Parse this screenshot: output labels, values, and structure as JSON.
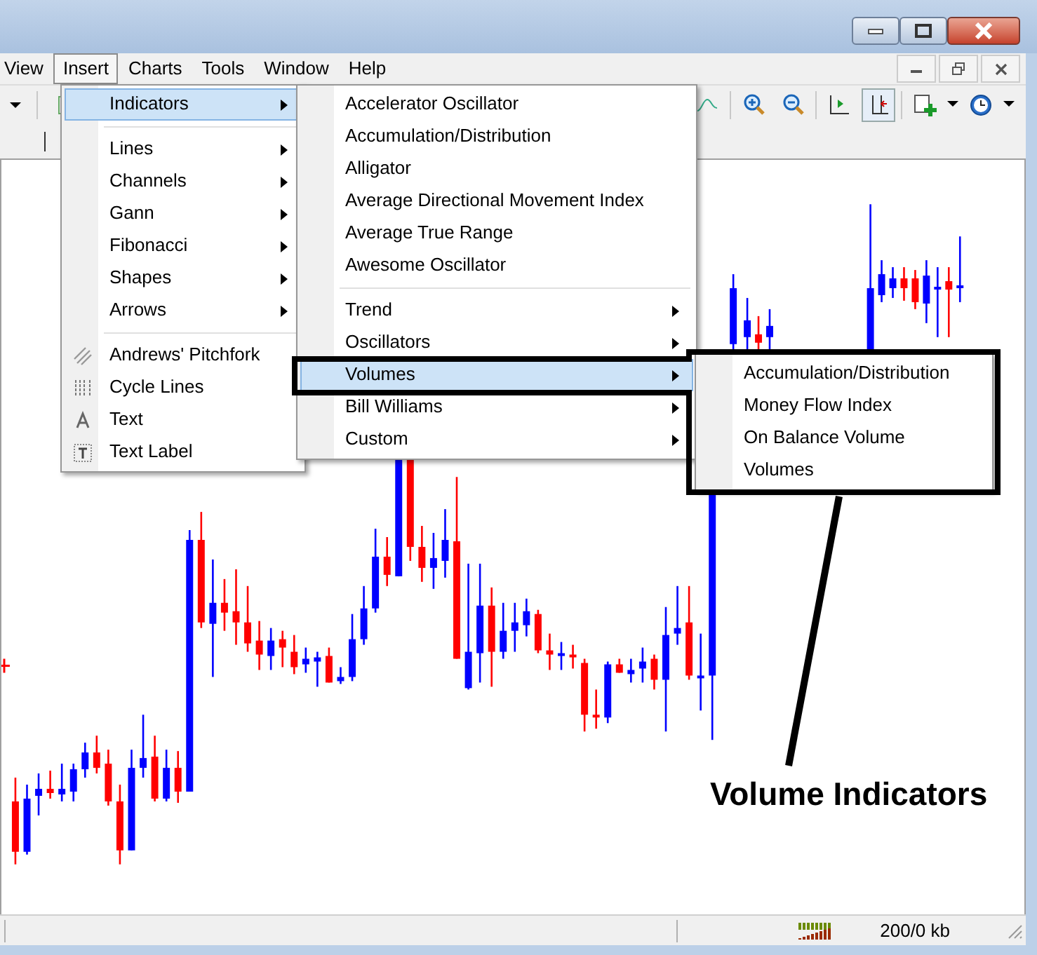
{
  "menu_bar": [
    {
      "label": "View",
      "selected": false
    },
    {
      "label": "Insert",
      "selected": true
    },
    {
      "label": "Charts",
      "selected": false
    },
    {
      "label": "Tools",
      "selected": false
    },
    {
      "label": "Window",
      "selected": false
    },
    {
      "label": "Help",
      "selected": false
    }
  ],
  "insert_menu": [
    {
      "kind": "submenu",
      "label": "Indicators",
      "selected": true
    },
    {
      "kind": "separator"
    },
    {
      "kind": "submenu",
      "label": "Lines",
      "selected": false
    },
    {
      "kind": "submenu",
      "label": "Channels",
      "selected": false
    },
    {
      "kind": "submenu",
      "label": "Gann",
      "selected": false
    },
    {
      "kind": "submenu",
      "label": "Fibonacci",
      "selected": false
    },
    {
      "kind": "submenu",
      "label": "Shapes",
      "selected": false
    },
    {
      "kind": "submenu",
      "label": "Arrows",
      "selected": false
    },
    {
      "kind": "separator"
    },
    {
      "kind": "command",
      "label": "Andrews' Pitchfork",
      "selected": false
    },
    {
      "kind": "command",
      "label": "Cycle Lines",
      "selected": false
    },
    {
      "kind": "command",
      "label": "Text",
      "selected": false
    },
    {
      "kind": "command",
      "label": "Text Label",
      "selected": false
    }
  ],
  "indicators_menu": [
    {
      "kind": "command",
      "label": "Accelerator Oscillator",
      "selected": false
    },
    {
      "kind": "command",
      "label": "Accumulation/Distribution",
      "selected": false
    },
    {
      "kind": "command",
      "label": "Alligator",
      "selected": false
    },
    {
      "kind": "command",
      "label": "Average Directional Movement Index",
      "selected": false
    },
    {
      "kind": "command",
      "label": "Average True Range",
      "selected": false
    },
    {
      "kind": "command",
      "label": "Awesome Oscillator",
      "selected": false
    },
    {
      "kind": "separator"
    },
    {
      "kind": "submenu",
      "label": "Trend",
      "selected": false
    },
    {
      "kind": "submenu",
      "label": "Oscillators",
      "selected": false
    },
    {
      "kind": "submenu",
      "label": "Volumes",
      "selected": true
    },
    {
      "kind": "submenu",
      "label": "Bill Williams",
      "selected": false
    },
    {
      "kind": "submenu",
      "label": "Custom",
      "selected": false
    }
  ],
  "volumes_menu": [
    {
      "kind": "command",
      "label": "Accumulation/Distribution",
      "selected": false
    },
    {
      "kind": "command",
      "label": "Money Flow Index",
      "selected": false
    },
    {
      "kind": "command",
      "label": "On Balance Volume",
      "selected": false
    },
    {
      "kind": "command",
      "label": "Volumes",
      "selected": false
    }
  ],
  "annotation": {
    "label": "Volume Indicators"
  },
  "status_bar": {
    "memory": "200/0 kb"
  }
}
